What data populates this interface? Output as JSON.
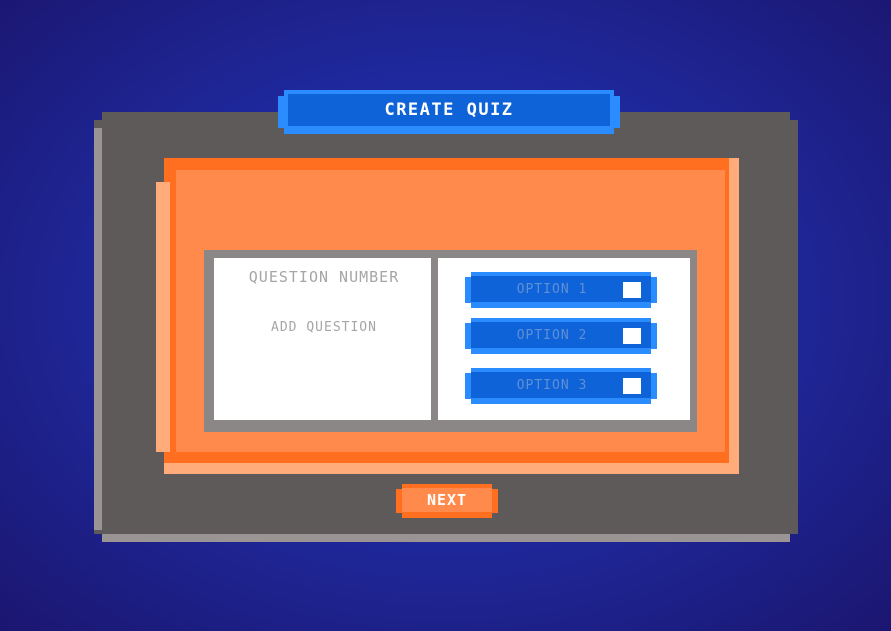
{
  "header": {
    "title": "CREATE QUIZ"
  },
  "question": {
    "number_label": "QUESTION NUMBER",
    "add_label": "ADD QUESTION"
  },
  "options": [
    {
      "label": "OPTION 1",
      "checked": false
    },
    {
      "label": "OPTION 2",
      "checked": false
    },
    {
      "label": "OPTION 3",
      "checked": false
    }
  ],
  "footer": {
    "next_label": "NEXT"
  },
  "colors": {
    "background": "#1f2aa0",
    "frame": "#5e5a59",
    "panel_orange": "#ff8a4c",
    "accent_blue": "#0f63d8",
    "button_orange": "#ff6f1f"
  }
}
